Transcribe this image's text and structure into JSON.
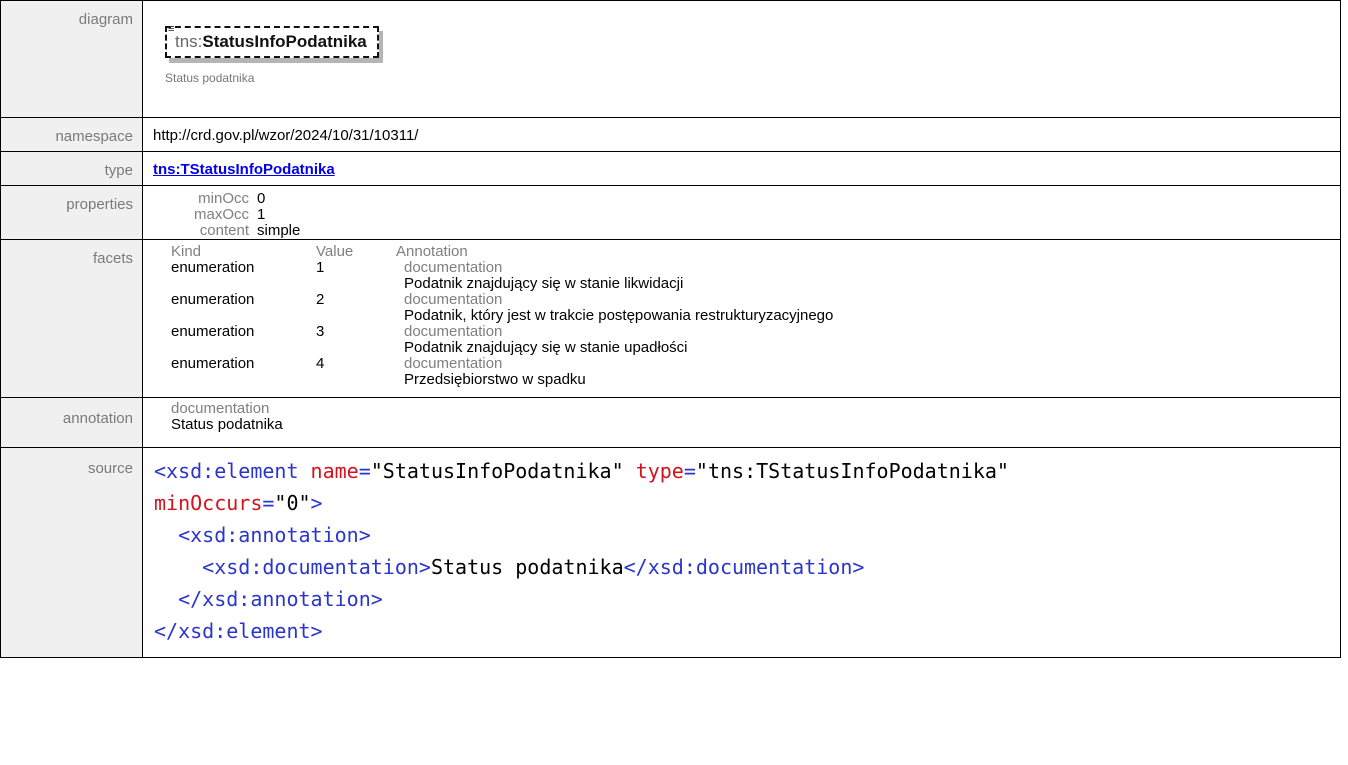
{
  "labels": {
    "diagram": "diagram",
    "namespace": "namespace",
    "type": "type",
    "properties": "properties",
    "facets": "facets",
    "annotation": "annotation",
    "source": "source"
  },
  "diagram": {
    "prefix": "tns:",
    "name": "StatusInfoPodatnika",
    "documentation": "Status podatnika"
  },
  "namespace": "http://crd.gov.pl/wzor/2024/10/31/10311/",
  "type": "tns:TStatusInfoPodatnika",
  "properties": [
    {
      "key": "minOcc",
      "value": "0"
    },
    {
      "key": "maxOcc",
      "value": "1"
    },
    {
      "key": "content",
      "value": "simple"
    }
  ],
  "facets": {
    "headers": {
      "kind": "Kind",
      "value": "Value",
      "annotation": "Annotation"
    },
    "rows": [
      {
        "kind": "enumeration",
        "value": "1",
        "doc_label": "documentation",
        "doc": "Podatnik znajdujący się w stanie likwidacji"
      },
      {
        "kind": "enumeration",
        "value": "2",
        "doc_label": "documentation",
        "doc": "Podatnik, który jest w trakcie postępowania restrukturyzacyjnego"
      },
      {
        "kind": "enumeration",
        "value": "3",
        "doc_label": "documentation",
        "doc": "Podatnik znajdujący się w stanie upadłości"
      },
      {
        "kind": "enumeration",
        "value": "4",
        "doc_label": "documentation",
        "doc": "Przedsiębiorstwo w spadku"
      }
    ]
  },
  "annotation": {
    "label": "documentation",
    "text": "Status podatnika"
  },
  "source": {
    "l1_tag": "<xsd:element",
    "l1_attr1": "name",
    "l1_val1": "\"StatusInfoPodatnika\"",
    "l1_attr2": "type",
    "l1_val2": "\"tns:TStatusInfoPodatnika\"",
    "l2_attr": "minOccurs",
    "l2_val": "\"0\"",
    "l2_close": ">",
    "l3_tag": "<xsd:annotation>",
    "l4_open": "<xsd:documentation>",
    "l4_text": "Status podatnika",
    "l4_close": "</xsd:documentation>",
    "l5_tag": "</xsd:annotation>",
    "l6_tag": "</xsd:element>"
  }
}
